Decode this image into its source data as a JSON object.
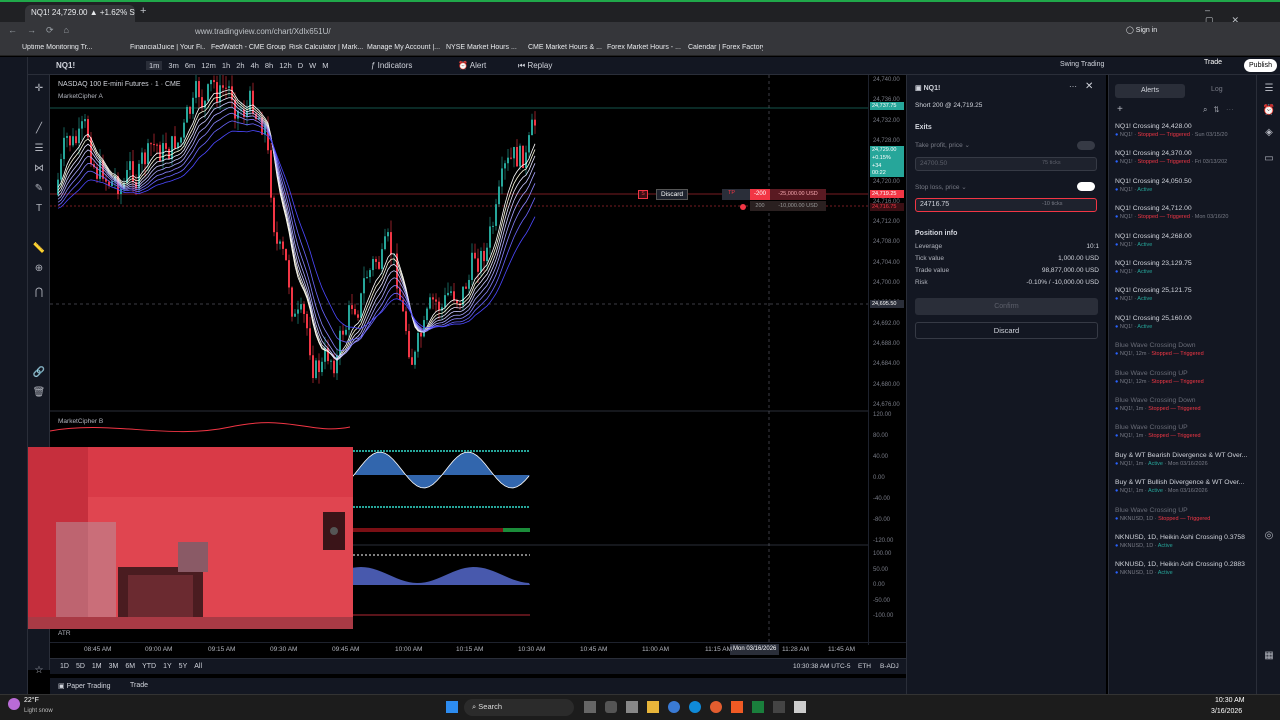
{
  "browser": {
    "tab_title": "NQ1! 24,729.00 ▲ +1.62% Swi…",
    "url": "www.tradingview.com/chart/Xdlx651U/"
  },
  "bookmarks": [
    "Uptime Monitoring Tr...",
    "FinancialJuice | Your Fi...",
    "FedWatch - CME Group",
    "Risk Calculator | Mark...",
    "Manage My Account |...",
    "NYSE Market Hours ...",
    "CME Market Hours & ...",
    "Forex Market Hours - ...",
    "Calendar | Forex Factory"
  ],
  "toolbar": {
    "symbol": "NQ1!",
    "intervals": [
      "1m",
      "3m",
      "6m",
      "12m",
      "1h",
      "2h",
      "4h",
      "8h",
      "12h",
      "D",
      "W",
      "M"
    ],
    "indicators": "Indicators",
    "alert": "Alert",
    "replay": "Replay",
    "layout_name": "Swing Trading",
    "layout_sub": "Save",
    "publish": "Publish",
    "trade": "Trade",
    "sign_in": "Sign in"
  },
  "chart": {
    "title": "NASDAQ 100 E-mini Futures · 1 · CME",
    "indicator_a": "MarketCipher A",
    "indicator_b": "MarketCipher B",
    "atr": "ATR",
    "price_labels": [
      "24,740.00",
      "24,736.00",
      "24,732.00",
      "24,728.00",
      "24,724.00",
      "24,720.00",
      "24,716.00",
      "24,712.00",
      "24,708.00",
      "24,704.00",
      "24,700.00",
      "24,696.00",
      "24,692.00",
      "24,688.00",
      "24,684.00",
      "24,680.00",
      "24,676.00"
    ],
    "price_tags": {
      "current": "24,737.75",
      "last": "24,729.00",
      "last_change": "+0.15%",
      "last_vol": "+34",
      "last_time": "00:22",
      "sl": "24,719.25",
      "sl2": "24,716.75",
      "cross": "24,695.50"
    },
    "osc_labels": [
      "120.00",
      "80.00",
      "40.00",
      "0.00",
      "-40.00",
      "-80.00",
      "-120.00"
    ],
    "osc2_labels": [
      "100.00",
      "50.00",
      "0.00",
      "-50.00",
      "-100.00"
    ],
    "order_line": {
      "discard": "Discard",
      "tp": "TP",
      "qty": "-200",
      "pnl": "-25,000.00 USD",
      "sl_qty": "200",
      "sl_pnl": "-10,000.00 USD"
    },
    "time_labels": [
      "08:45 AM",
      "09:00 AM",
      "09:15 AM",
      "09:30 AM",
      "09:45 AM",
      "10:00 AM",
      "10:15 AM",
      "10:30 AM",
      "10:45 AM",
      "11:00 AM",
      "11:15 AM",
      "11:28 AM",
      "11:45 AM"
    ],
    "crosshair_date": "Mon 03/16/2026"
  },
  "bottom": {
    "ranges": [
      "1D",
      "5D",
      "1M",
      "3M",
      "6M",
      "YTD",
      "1Y",
      "5Y",
      "All"
    ],
    "clock": "10:30:38 AM UTC-5",
    "session": "ETH",
    "adj": "B-ADJ",
    "paper": "Paper Trading",
    "trade": "Trade"
  },
  "order_panel": {
    "symbol": "NQ1!",
    "subtitle": "Short 200 @ 24,719.25",
    "exits": "Exits",
    "take_profit": "Take profit, price",
    "tp_value": "24700.50",
    "tp_ticks": "75 ticks",
    "stop_loss": "Stop loss, price",
    "sl_value": "24716.75",
    "sl_ticks": "-10 ticks",
    "position_info": "Position info",
    "rows": [
      {
        "k": "Leverage",
        "v": "10:1"
      },
      {
        "k": "Tick value",
        "v": "1,000.00 USD"
      },
      {
        "k": "Trade value",
        "v": "98,877,000.00 USD"
      },
      {
        "k": "Risk",
        "v": "-0.10% / -10,000.00 USD"
      }
    ],
    "confirm": "Confirm",
    "discard": "Discard"
  },
  "alerts_panel": {
    "tab_alerts": "Alerts",
    "tab_log": "Log",
    "items": [
      {
        "t": "NQ1! Crossing 24,428.00",
        "s": "NQ1!",
        "st": "Stopped — Triggered",
        "d": "Sun 03/15/20",
        "c": "stp"
      },
      {
        "t": "NQ1! Crossing 24,370.00",
        "s": "NQ1!",
        "st": "Stopped — Triggered",
        "d": "Fri 03/13/202",
        "c": "stp"
      },
      {
        "t": "NQ1! Crossing 24,050.50",
        "s": "NQ1!",
        "st": "Active",
        "d": "",
        "c": "act"
      },
      {
        "t": "NQ1! Crossing 24,712.00",
        "s": "NQ1!",
        "st": "Stopped — Triggered",
        "d": "Mon 03/16/20",
        "c": "stp"
      },
      {
        "t": "NQ1! Crossing 24,268.00",
        "s": "NQ1!",
        "st": "Active",
        "d": "",
        "c": "act"
      },
      {
        "t": "NQ1! Crossing 23,129.75",
        "s": "NQ1!",
        "st": "Active",
        "d": "",
        "c": "act"
      },
      {
        "t": "NQ1! Crossing 25,121.75",
        "s": "NQ1!",
        "st": "Active",
        "d": "",
        "c": "act"
      },
      {
        "t": "NQ1! Crossing 25,160.00",
        "s": "NQ1!",
        "st": "Active",
        "d": "",
        "c": "act"
      },
      {
        "t": "Blue Wave Crossing Down",
        "s": "NQ1!, 12m",
        "st": "Stopped — Triggered",
        "d": "",
        "c": "stp",
        "dim": true
      },
      {
        "t": "Blue Wave Crossing UP",
        "s": "NQ1!, 12m",
        "st": "Stopped — Triggered",
        "d": "",
        "c": "stp",
        "dim": true
      },
      {
        "t": "Blue Wave Crossing Down",
        "s": "NQ1!, 1m",
        "st": "Stopped — Triggered",
        "d": "",
        "c": "stp",
        "dim": true
      },
      {
        "t": "Blue Wave Crossing UP",
        "s": "NQ1!, 1m",
        "st": "Stopped — Triggered",
        "d": "",
        "c": "stp",
        "dim": true
      },
      {
        "t": "Buy & WT Bearish Divergence & WT Over...",
        "s": "NQ1!, 1m",
        "st": "Active",
        "d": "Mon 03/16/2026",
        "c": "act"
      },
      {
        "t": "Buy & WT Bullish Divergence & WT Over...",
        "s": "NQ1!, 1m",
        "st": "Active",
        "d": "Mon 03/16/2026",
        "c": "act"
      },
      {
        "t": "Blue Wave Crossing UP",
        "s": "NKNUSD, 1D",
        "st": "Stopped — Triggered",
        "d": "",
        "c": "stp",
        "dim": true
      },
      {
        "t": "NKNUSD, 1D, Heikin Ashi Crossing 0.3758",
        "s": "NKNUSD, 1D",
        "st": "Active",
        "d": "",
        "c": "act"
      },
      {
        "t": "NKNUSD, 1D, Heikin Ashi Crossing 0.2883",
        "s": "NKNUSD, 1D",
        "st": "Active",
        "d": "",
        "c": "act"
      }
    ]
  },
  "taskbar": {
    "weather_temp": "22°F",
    "weather_desc": "Light snow",
    "search": "Search",
    "time": "10:30 AM",
    "date": "3/16/2026"
  }
}
